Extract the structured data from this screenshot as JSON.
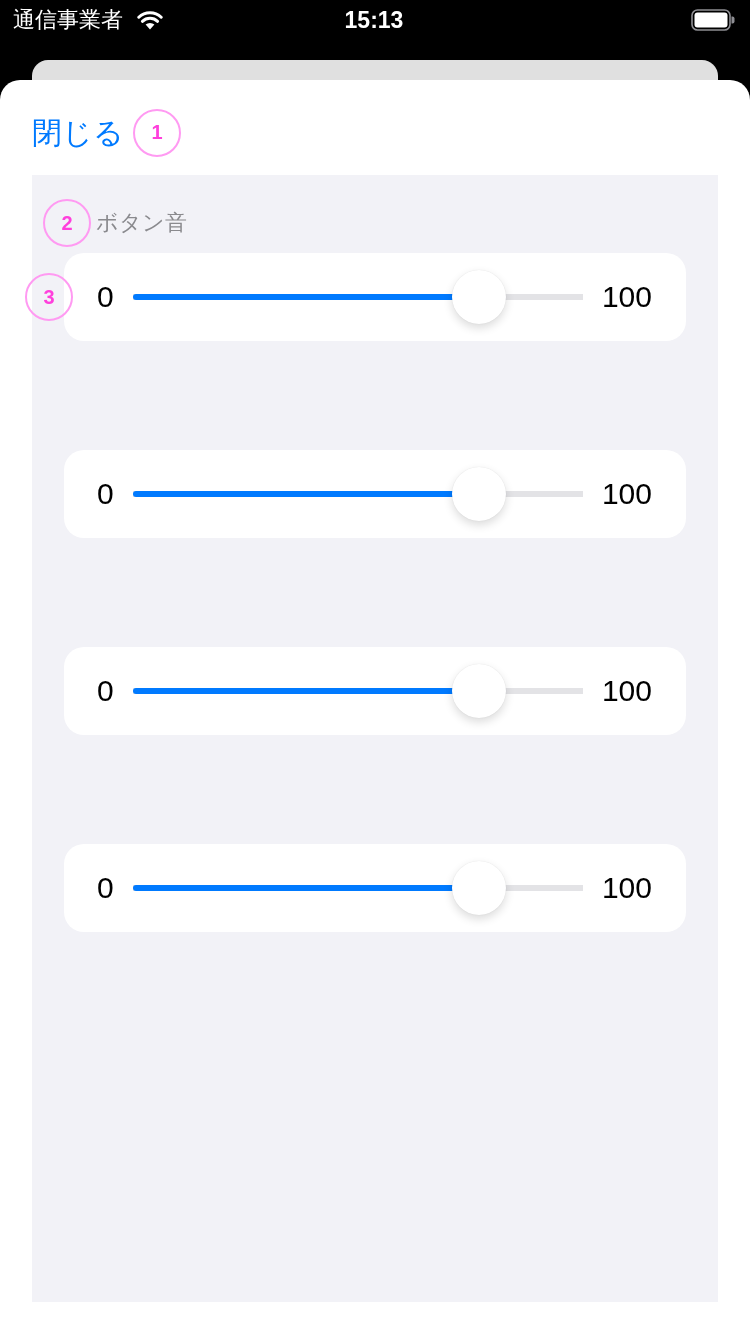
{
  "status_bar": {
    "carrier": "通信事業者",
    "time": "15:13"
  },
  "close_button": {
    "label": "閉じる",
    "annotation": "1"
  },
  "sections": [
    {
      "header": {
        "label": "ボタン音",
        "annotation": "2"
      },
      "slider": {
        "min_label": "0",
        "max_label": "100",
        "level": 0.77,
        "annotation": "3"
      }
    },
    {
      "slider": {
        "min_label": "0",
        "max_label": "100",
        "level": 0.77
      }
    },
    {
      "slider": {
        "min_label": "0",
        "max_label": "100",
        "level": 0.77
      }
    },
    {
      "slider": {
        "min_label": "0",
        "max_label": "100",
        "level": 0.77
      }
    }
  ]
}
